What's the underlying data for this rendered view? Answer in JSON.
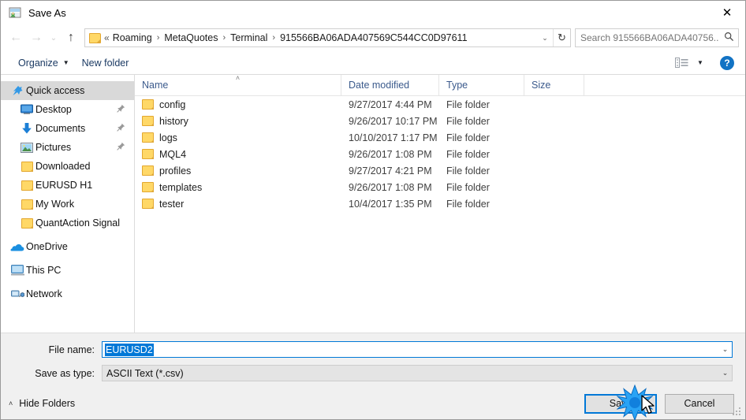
{
  "window": {
    "title": "Save As",
    "title_icon": "save-as-icon",
    "close_label": "✕"
  },
  "nav": {
    "back_icon": "←",
    "forward_icon": "→",
    "recent_icon": "⌄",
    "up_icon": "↑",
    "refresh_icon": "↻",
    "dropdown_icon": "⌄",
    "breadcrumb_prefix": "«",
    "breadcrumb": [
      "Roaming",
      "MetaQuotes",
      "Terminal",
      "915566BA06ADA407569C544CC0D97611"
    ],
    "separator": "›"
  },
  "search": {
    "placeholder": "Search 915566BA06ADA40756...",
    "icon": "search-icon"
  },
  "toolbar": {
    "organize_label": "Organize",
    "organize_caret": "▼",
    "new_folder_label": "New folder",
    "view_icon": "list-view-icon",
    "view_caret": "▼",
    "help_label": "?"
  },
  "sidebar": {
    "items": [
      {
        "label": "Quick access",
        "icon": "star-pin-icon",
        "level": 0,
        "selected": true,
        "pinned": false
      },
      {
        "label": "Desktop",
        "icon": "desktop-icon",
        "level": 1,
        "selected": false,
        "pinned": true
      },
      {
        "label": "Documents",
        "icon": "documents-download-icon",
        "level": 1,
        "selected": false,
        "pinned": true
      },
      {
        "label": "Pictures",
        "icon": "pictures-icon",
        "level": 1,
        "selected": false,
        "pinned": true
      },
      {
        "label": "Downloaded",
        "icon": "folder-icon",
        "level": 1,
        "selected": false,
        "pinned": false
      },
      {
        "label": "EURUSD H1",
        "icon": "folder-icon",
        "level": 1,
        "selected": false,
        "pinned": false
      },
      {
        "label": "My Work",
        "icon": "folder-icon",
        "level": 1,
        "selected": false,
        "pinned": false
      },
      {
        "label": "QuantAction Signal",
        "icon": "folder-icon",
        "level": 1,
        "selected": false,
        "pinned": false
      },
      {
        "label": "OneDrive",
        "icon": "onedrive-cloud-icon",
        "level": 0,
        "selected": false,
        "pinned": false,
        "gap_before": true
      },
      {
        "label": "This PC",
        "icon": "this-pc-icon",
        "level": 0,
        "selected": false,
        "pinned": false,
        "gap_before": true
      },
      {
        "label": "Network",
        "icon": "network-icon",
        "level": 0,
        "selected": false,
        "pinned": false,
        "gap_before": true
      }
    ],
    "pin_glyph": "📌"
  },
  "filelist": {
    "columns": [
      "Name",
      "Date modified",
      "Type",
      "Size"
    ],
    "sort_column": "Name",
    "sort_caret": "˄",
    "rows": [
      {
        "name": "config",
        "date": "9/27/2017 4:44 PM",
        "type": "File folder",
        "size": ""
      },
      {
        "name": "history",
        "date": "9/26/2017 10:17 PM",
        "type": "File folder",
        "size": ""
      },
      {
        "name": "logs",
        "date": "10/10/2017 1:17 PM",
        "type": "File folder",
        "size": ""
      },
      {
        "name": "MQL4",
        "date": "9/26/2017 1:08 PM",
        "type": "File folder",
        "size": ""
      },
      {
        "name": "profiles",
        "date": "9/27/2017 4:21 PM",
        "type": "File folder",
        "size": ""
      },
      {
        "name": "templates",
        "date": "9/26/2017 1:08 PM",
        "type": "File folder",
        "size": ""
      },
      {
        "name": "tester",
        "date": "10/4/2017 1:35 PM",
        "type": "File folder",
        "size": ""
      }
    ]
  },
  "form": {
    "filename_label": "File name:",
    "filename_value": "EURUSD2",
    "filename_selected": true,
    "filetype_label": "Save as type:",
    "filetype_value": "ASCII Text (*.csv)",
    "dropdown_icon": "⌄"
  },
  "footer": {
    "hide_folders_label": "Hide Folders",
    "hide_folders_caret": "˄",
    "save_label": "Save",
    "cancel_label": "Cancel"
  },
  "colors": {
    "accent": "#0078d7",
    "folder_yellow": "#ffd867",
    "selection_gray": "#d9d9d9",
    "header_blue": "#3b5a8c",
    "panel_gray": "#f0f0f0",
    "help_blue": "#1273c4"
  }
}
